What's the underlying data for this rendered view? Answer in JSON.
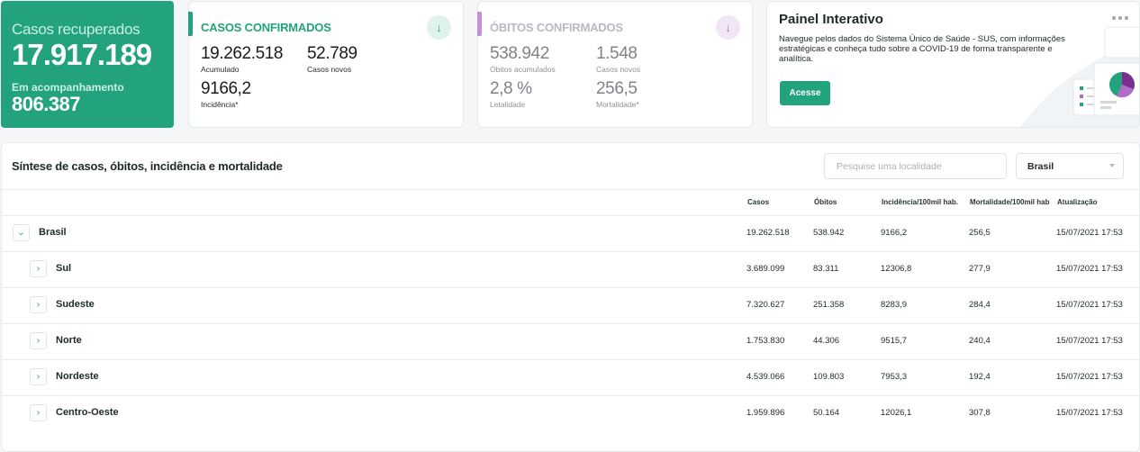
{
  "recovered": {
    "label": "Casos recuperados",
    "value": "17.917.189",
    "followup_label": "Em acompanhamento",
    "followup_value": "806.387"
  },
  "confirmed": {
    "title": "CASOS CONFIRMADOS",
    "accumulated": "19.262.518",
    "accumulated_label": "Acumulado",
    "new_cases": "52.789",
    "new_cases_label": "Casos novos",
    "incidence": "9166,2",
    "incidence_label": "Incidência*"
  },
  "deaths": {
    "title": "ÓBITOS CONFIRMADOS",
    "accumulated": "538.942",
    "accumulated_label": "Óbitos acumulados",
    "new_cases": "1.548",
    "new_cases_label": "Casos novos",
    "lethality": "2,8 %",
    "lethality_label": "Letalidade",
    "mortality": "256,5",
    "mortality_label": "Mortalidade*"
  },
  "panel": {
    "title": "Painel Interativo",
    "text": "Navegue pelos dados do Sistema Único de Saúde - SUS, com informações estratégicas e conheça tudo sobre a COVID-19 de forma transparente e analítica.",
    "button": "Acesse"
  },
  "table": {
    "title": "Síntese de casos, óbitos, incidência e mortalidade",
    "search_placeholder": "Pesquise uma localidade",
    "selected_location": "Brasil",
    "headers": {
      "cases": "Casos",
      "deaths": "Óbitos",
      "incidence": "Incidência/100mil hab.",
      "mortality": "Mortalidade/100mil hab",
      "updated": "Atualização"
    },
    "rows": [
      {
        "name": "Brasil",
        "cases": "19.262.518",
        "deaths": "538.942",
        "incidence": "9166,2",
        "mortality": "256,5",
        "updated": "15/07/2021 17:53",
        "toggle": "⌄"
      },
      {
        "name": "Sul",
        "cases": "3.689.099",
        "deaths": "83.311",
        "incidence": "12306,8",
        "mortality": "277,9",
        "updated": "15/07/2021 17:53",
        "toggle": "›"
      },
      {
        "name": "Sudeste",
        "cases": "7.320.627",
        "deaths": "251.358",
        "incidence": "8283,9",
        "mortality": "284,4",
        "updated": "15/07/2021 17:53",
        "toggle": "›"
      },
      {
        "name": "Norte",
        "cases": "1.753.830",
        "deaths": "44.306",
        "incidence": "9515,7",
        "mortality": "240,4",
        "updated": "15/07/2021 17:53",
        "toggle": "›"
      },
      {
        "name": "Nordeste",
        "cases": "4.539.066",
        "deaths": "109.803",
        "incidence": "7953,3",
        "mortality": "192,4",
        "updated": "15/07/2021 17:53",
        "toggle": "›"
      },
      {
        "name": "Centro-Oeste",
        "cases": "1.959.896",
        "deaths": "50.164",
        "incidence": "12026,1",
        "mortality": "307,8",
        "updated": "15/07/2021 17:53",
        "toggle": "›"
      }
    ]
  },
  "colors": {
    "accent": "#23a37d",
    "deaths_accent": "#c48ed8"
  },
  "icons": {
    "confirmed_arrow": "arrow-down-icon",
    "deaths_arrow": "arrow-down-icon",
    "expand": "chevron-right-icon",
    "collapse": "chevron-down-icon"
  }
}
